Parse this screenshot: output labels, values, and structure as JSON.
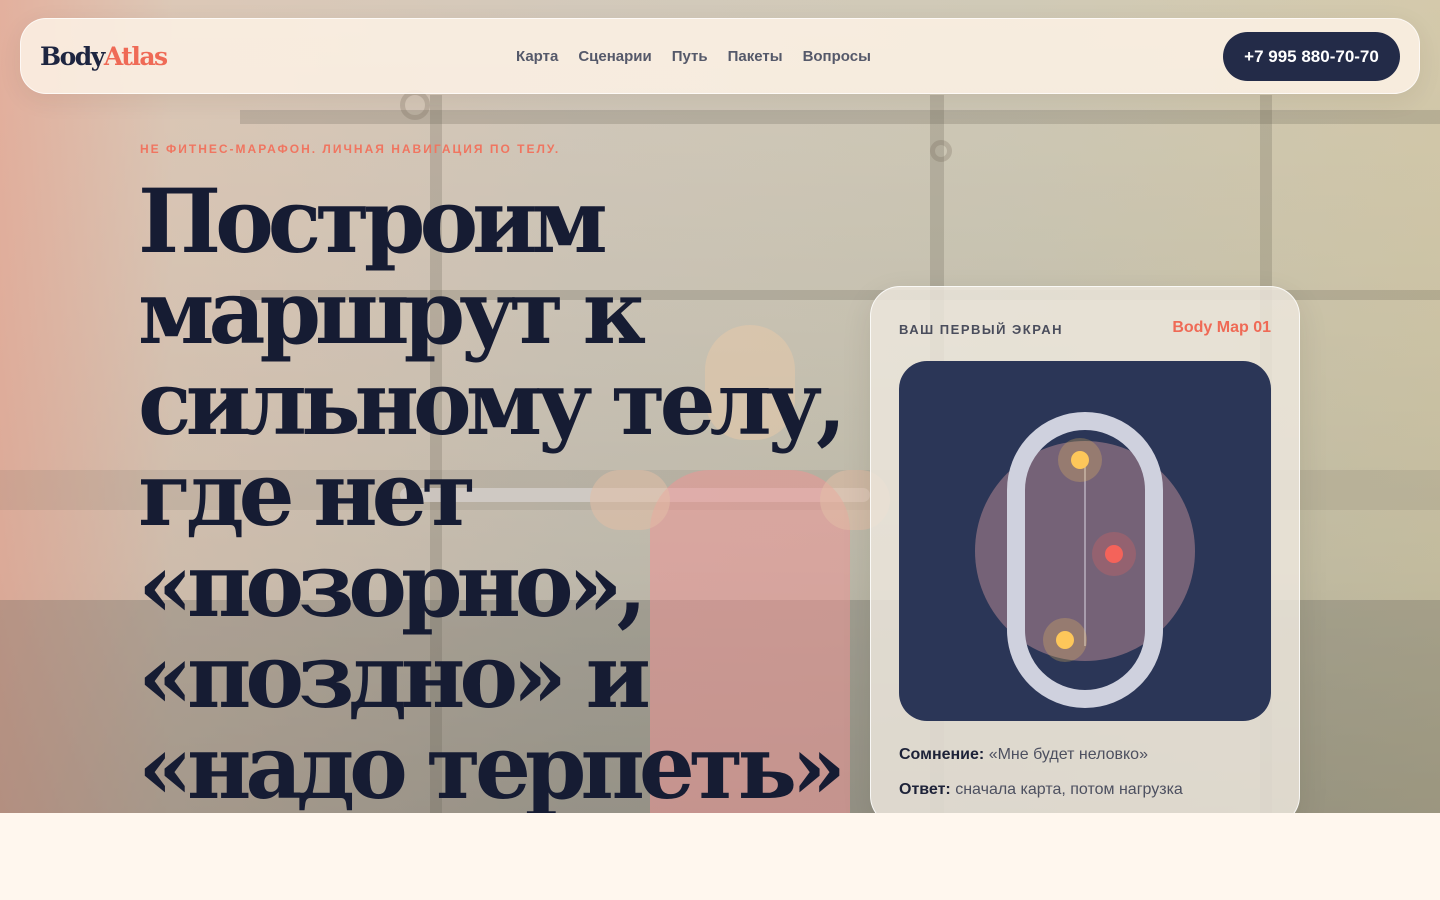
{
  "brand": {
    "logo_part1": "Body",
    "logo_part2": "Atlas"
  },
  "nav": {
    "items": [
      {
        "label": "Карта"
      },
      {
        "label": "Сценарии"
      },
      {
        "label": "Путь"
      },
      {
        "label": "Пакеты"
      },
      {
        "label": "Вопросы"
      }
    ],
    "phone": "+7 995 880-70-70"
  },
  "hero": {
    "eyebrow": "НЕ ФИТНЕС-МАРАФОН. ЛИЧНАЯ НАВИГАЦИЯ ПО ТЕЛУ.",
    "headline_lines": [
      "Построим",
      "маршрут к",
      "сильному телу,",
      "где нет",
      "«позорно»,",
      "«поздно» и",
      "«надо терпеть»"
    ]
  },
  "card": {
    "tag": "ВАШ ПЕРВЫЙ ЭКРАН",
    "map_id": "Body Map 01",
    "doubt_label": "Сомнение:",
    "doubt_text": "«Мне будет неловко»",
    "answer_label": "Ответ:",
    "answer_text": "сначала карта, потом нагрузка"
  },
  "colors": {
    "accent": "#ef6a56",
    "navy": "#232b48",
    "map_bg": "#2b3657",
    "point_yellow": "#fdc75a",
    "point_red": "#f4635a"
  }
}
